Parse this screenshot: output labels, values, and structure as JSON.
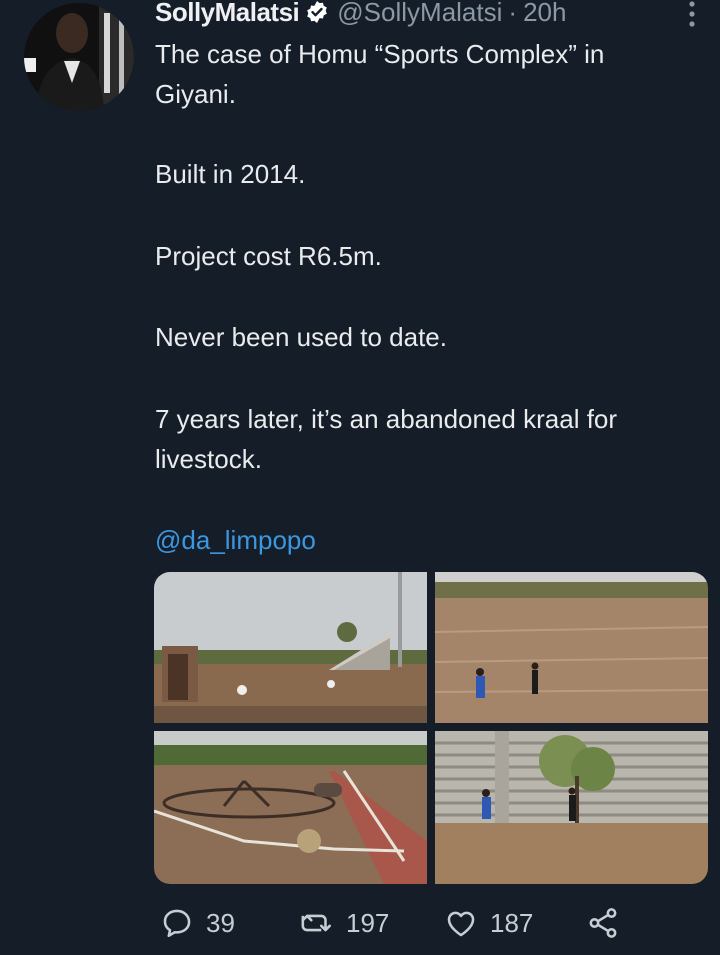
{
  "tweet": {
    "display_name": "SollyMalatsi",
    "handle": "@SollyMalatsi",
    "separator": "·",
    "time": "20h",
    "lines": [
      "The case of Homu “Sports Complex” in",
      "Giyani.",
      "Built in 2014.",
      "Project cost R6.5m.",
      "Never been used to date.",
      "7 years later, it’s an abandoned kraal for",
      "livestock."
    ],
    "mention": "@da_limpopo"
  },
  "actions": {
    "replies": "39",
    "retweets": "197",
    "likes": "187"
  },
  "icons": {
    "verified": "verified-badge-icon",
    "more": "more-options-icon",
    "reply": "reply-icon",
    "retweet": "retweet-icon",
    "like": "heart-icon",
    "share": "share-icon"
  },
  "colors": {
    "background": "#151d28",
    "link": "#3a97e0",
    "muted": "#8b98a5"
  }
}
